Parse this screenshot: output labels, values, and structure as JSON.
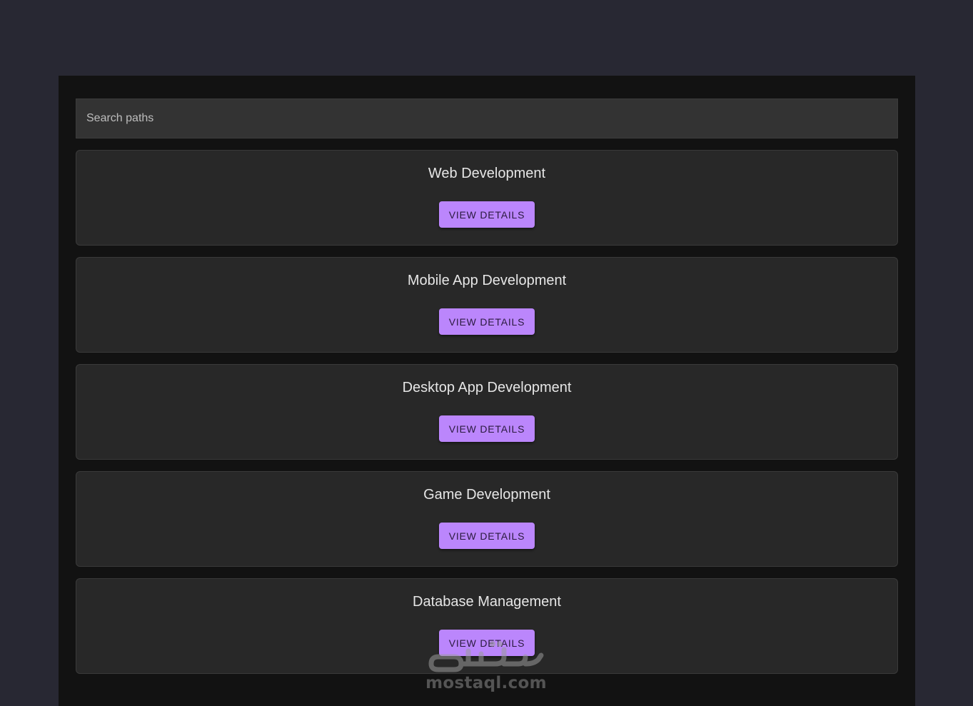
{
  "search": {
    "placeholder": "Search paths",
    "value": ""
  },
  "cards": [
    {
      "title": "Web Development",
      "button_label": "VIEW DETAILS"
    },
    {
      "title": "Mobile App Development",
      "button_label": "VIEW DETAILS"
    },
    {
      "title": "Desktop App Development",
      "button_label": "VIEW DETAILS"
    },
    {
      "title": "Game Development",
      "button_label": "VIEW DETAILS"
    },
    {
      "title": "Database Management",
      "button_label": "VIEW DETAILS"
    }
  ],
  "watermark": {
    "logo_text": "مستقل",
    "site": "mostaql.com"
  },
  "colors": {
    "page_bg": "#282833",
    "panel_bg": "#121212",
    "card_bg": "#282828",
    "accent": "#bb86fc"
  }
}
